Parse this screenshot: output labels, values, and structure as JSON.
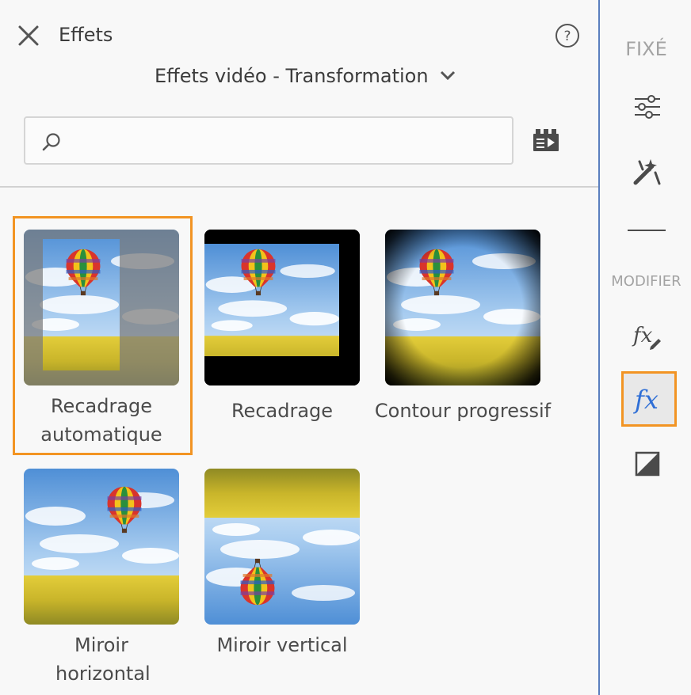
{
  "header": {
    "title": "Effets",
    "category": "Effets vidéo - Transformation"
  },
  "search": {
    "value": "",
    "placeholder": ""
  },
  "effects": [
    {
      "label": "Recadrage automatique",
      "selected": true
    },
    {
      "label": "Recadrage",
      "selected": false
    },
    {
      "label": "Contour progressif",
      "selected": false
    },
    {
      "label": "Miroir horizontal",
      "selected": false
    },
    {
      "label": "Miroir vertical",
      "selected": false
    }
  ],
  "rail": {
    "pinned_heading": "FIXÉ",
    "modify_heading": "MODIFIER",
    "icons": [
      "adjust-sliders-icon",
      "magic-wand-icon",
      "fx-edit-icon",
      "fx-icon",
      "color-contrast-icon"
    ],
    "active_icon": "fx-icon"
  },
  "colors": {
    "accent": "#f29423",
    "fx_blue": "#2f6fd6",
    "rail_border": "#5a7fbf",
    "background": "#f8f8f8"
  }
}
